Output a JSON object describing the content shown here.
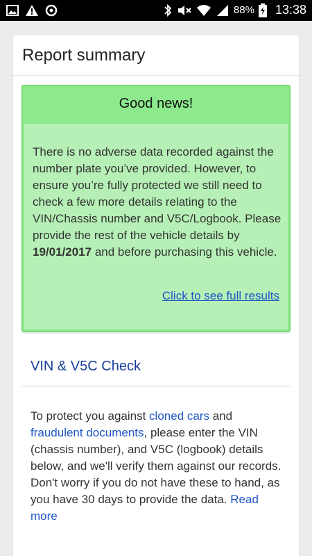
{
  "status_bar": {
    "battery": "88%",
    "time": "13:38",
    "left_icons": [
      "gallery-icon",
      "warning-icon",
      "sync-icon"
    ],
    "right_icons": [
      "bluetooth-icon",
      "mute-icon",
      "wifi-icon",
      "signal-icon",
      "battery-icon"
    ]
  },
  "summary": {
    "title": "Report summary",
    "news": {
      "heading": "Good news!",
      "text_before": "There is no adverse data recorded against the number plate you’ve provided. However, to ensure you’re fully protected we still need to check a few more details relating to the VIN/Chassis number and V5C/Logbook. Please provide the rest of the vehicle details by ",
      "deadline": "19/01/2017",
      "text_after": " and before purchasing this vehicle.",
      "link": "Click to see full results"
    }
  },
  "vin_check": {
    "title": "VIN & V5C Check",
    "p1_before": "To protect you against ",
    "link_cloned": "cloned cars",
    "p1_mid": " and ",
    "link_fraud": "fraudulent documents",
    "p1_after": ", please enter the VIN (chassis number), and V5C (logbook) details below, and we'll verify them against our records.",
    "p2": "Don't worry if you do not have these to hand, as you have 30 days to provide the data. ",
    "read_more": "Read more"
  },
  "colors": {
    "news_header": "#8cea8c",
    "news_body": "#b6f0b6",
    "link": "#1e56c8",
    "section_title": "#1a3e9a"
  }
}
